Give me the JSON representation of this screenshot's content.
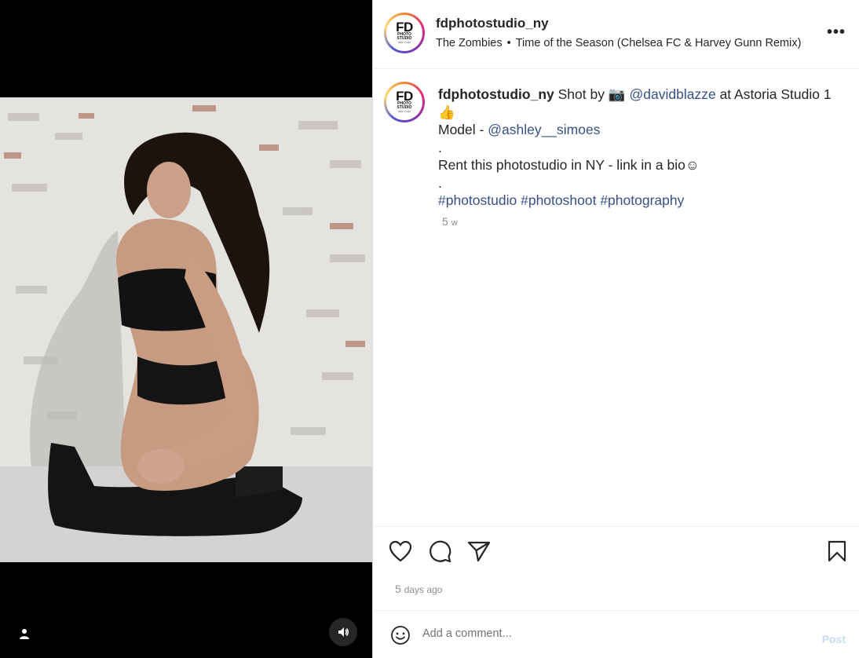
{
  "post": {
    "username": "fdphotostudio_ny",
    "avatar_logo": {
      "big": "FD",
      "line1": "PHOTO",
      "line2": "STUDIO",
      "line3": "NEW YORK"
    },
    "audio": {
      "artist": "The Zombies",
      "separator": "•",
      "track": "Time of the Season (Chelsea FC & Harvey Gunn Remix)"
    },
    "more_label": "•••"
  },
  "caption": {
    "username": "fdphotostudio_ny",
    "shot_by": " Shot by ",
    "camera_emoji": "📷",
    "photographer": "@davidblazze",
    "location": " at Astoria Studio 1 ",
    "thumb_emoji": "👍",
    "model_prefix": "Model - ",
    "model_handle": "@ashley__simoes",
    "dot1": ".",
    "rent_line": "Rent this photostudio in NY - link in a bio",
    "smile_emoji": "☺",
    "dot2": ".",
    "hashtags": [
      "#photostudio",
      "#photoshoot",
      "#photography"
    ],
    "age_num": "5",
    "age_unit": "w"
  },
  "footer": {
    "posted_num": "5",
    "posted_unit": "days ago",
    "comment_placeholder": "Add a comment...",
    "post_label": "Post"
  },
  "icons": {
    "like": "heart-icon",
    "comment": "comment-icon",
    "share": "share-icon",
    "save": "bookmark-icon",
    "emoji": "emoji-icon",
    "user_tag": "user-icon",
    "audio": "speaker-icon"
  },
  "colors": {
    "link": "#385185",
    "post_disabled": "#c7dcf7",
    "muted": "#8e8e8e"
  }
}
